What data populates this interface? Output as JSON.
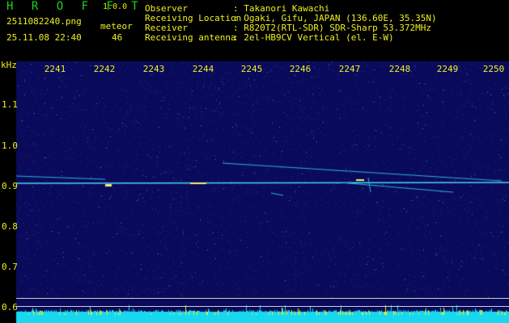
{
  "app": {
    "name": "H R O F F T",
    "version": "1.0.0",
    "filename": "2511082240.png",
    "datetime": "25.11.08 22:40",
    "meteor_label": "meteor",
    "meteor_count": "46"
  },
  "info": [
    {
      "key": "Observer",
      "value": ": Takanori Kawachi"
    },
    {
      "key": "Receiving Location",
      "value": ": Ogaki, Gifu, JAPAN (136.60E, 35.35N)"
    },
    {
      "key": "Receiver",
      "value": ": R820T2(RTL-SDR) SDR-Sharp 53.372MHz"
    },
    {
      "key": "Receiving antenna",
      "value": ": 2el-HB9CV Vertical (el. E-W)"
    }
  ],
  "axes": {
    "y_unit": "kHz",
    "x_ticks": [
      "2241",
      "2242",
      "2243",
      "2244",
      "2245",
      "2246",
      "2247",
      "2248",
      "2249",
      "2250"
    ],
    "y_ticks": [
      "1.1",
      "1.0",
      "0.9",
      "0.8",
      "0.7",
      "0.6"
    ]
  },
  "colors": {
    "background": "#000000",
    "plot_bg": "#0a0a5a",
    "label_yellow": "#f0f020",
    "label_green": "#1fd21f",
    "baseline_cyan": "#18d8f0"
  }
}
